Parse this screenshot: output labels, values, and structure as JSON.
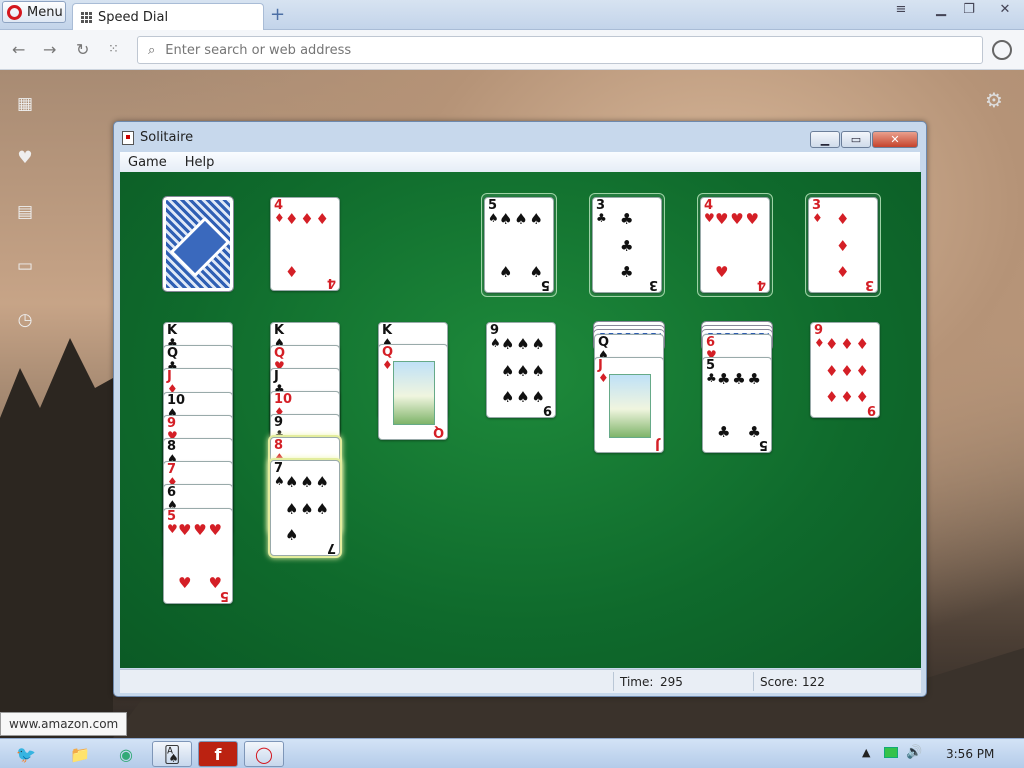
{
  "browser": {
    "menu_label": "Menu",
    "tab_title": "Speed Dial",
    "omnibox_placeholder": "Enter search or web address",
    "status_url": "www.amazon.com"
  },
  "window": {
    "title": "Solitaire",
    "menu": [
      "Game",
      "Help"
    ],
    "time_label": "Time:",
    "time_value": "295",
    "score_label": "Score:",
    "score_value": "122"
  },
  "stock": {
    "waste_top": {
      "rank": "4",
      "suit": "♦"
    }
  },
  "foundations": [
    {
      "rank": "5",
      "suit": "♠"
    },
    {
      "rank": "3",
      "suit": "♣"
    },
    {
      "rank": "4",
      "suit": "♥"
    },
    {
      "rank": "3",
      "suit": "♦"
    }
  ],
  "tableau": [
    [
      {
        "rank": "K",
        "suit": "♣"
      },
      {
        "rank": "Q",
        "suit": "♣"
      },
      {
        "rank": "J",
        "suit": "♦"
      },
      {
        "rank": "10",
        "suit": "♠"
      },
      {
        "rank": "9",
        "suit": "♥"
      },
      {
        "rank": "8",
        "suit": "♠"
      },
      {
        "rank": "7",
        "suit": "♦"
      },
      {
        "rank": "6",
        "suit": "♠"
      },
      {
        "rank": "5",
        "suit": "♥"
      }
    ],
    [
      {
        "rank": "K",
        "suit": "♠"
      },
      {
        "rank": "Q",
        "suit": "♥"
      },
      {
        "rank": "J",
        "suit": "♣"
      },
      {
        "rank": "10",
        "suit": "♦"
      },
      {
        "rank": "9",
        "suit": "♣"
      },
      {
        "rank": "8",
        "suit": "♦"
      },
      {
        "rank": "7",
        "suit": "♠"
      }
    ],
    [
      {
        "rank": "K",
        "suit": "♠"
      },
      {
        "rank": "Q",
        "suit": "♦"
      }
    ],
    [
      {
        "rank": "9",
        "suit": "♠"
      }
    ],
    [
      {
        "rank": "Q",
        "suit": "♠"
      },
      {
        "rank": "J",
        "suit": "♦"
      }
    ],
    [
      {
        "rank": "6",
        "suit": "♥"
      },
      {
        "rank": "5",
        "suit": "♣"
      }
    ],
    [
      {
        "rank": "9",
        "suit": "♦"
      }
    ]
  ],
  "taskbar": {
    "clock": "3:56 PM"
  },
  "colors": {
    "felt": "#0f6a2c",
    "red_suit": "#d41f26",
    "black_suit": "#111111"
  }
}
